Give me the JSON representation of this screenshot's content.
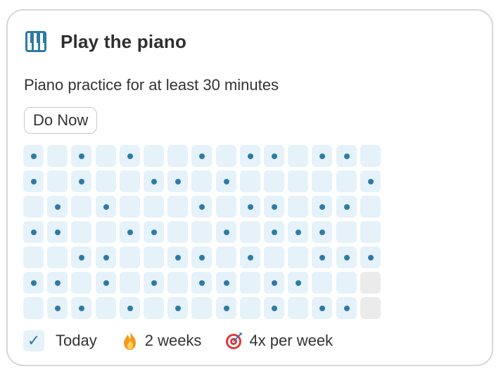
{
  "habit": {
    "title": "Play the piano",
    "icon": "piano-keys-icon",
    "description": "Piano practice for at least 30 minutes",
    "action_label": "Do Now",
    "accent_color": "#2e7aa6"
  },
  "history": {
    "columns": 15,
    "rows": 7,
    "done_color": "#2e7aa6",
    "cell_color": "#e5f2f9",
    "future_color": "#ebebeb",
    "grid": [
      [
        1,
        0,
        1,
        0,
        1,
        0,
        0,
        1,
        0,
        1,
        1,
        0,
        1,
        1,
        0
      ],
      [
        1,
        0,
        1,
        0,
        0,
        1,
        1,
        0,
        1,
        0,
        0,
        0,
        0,
        0,
        1
      ],
      [
        0,
        1,
        0,
        1,
        0,
        0,
        0,
        1,
        0,
        1,
        1,
        0,
        1,
        1,
        0
      ],
      [
        1,
        1,
        0,
        0,
        1,
        1,
        0,
        0,
        1,
        0,
        1,
        1,
        1,
        0,
        0
      ],
      [
        0,
        0,
        1,
        1,
        0,
        0,
        1,
        1,
        0,
        1,
        0,
        0,
        1,
        1,
        1
      ],
      [
        1,
        1,
        0,
        1,
        0,
        1,
        0,
        1,
        1,
        0,
        1,
        1,
        0,
        0,
        2
      ],
      [
        0,
        1,
        1,
        0,
        1,
        0,
        1,
        0,
        1,
        0,
        1,
        0,
        1,
        1,
        2
      ]
    ]
  },
  "footer": {
    "today_check": "✓",
    "today_label": "Today",
    "streak_icon": "fire-icon",
    "streak_label": "2 weeks",
    "goal_icon": "target-icon",
    "goal_label": "4x per week"
  }
}
